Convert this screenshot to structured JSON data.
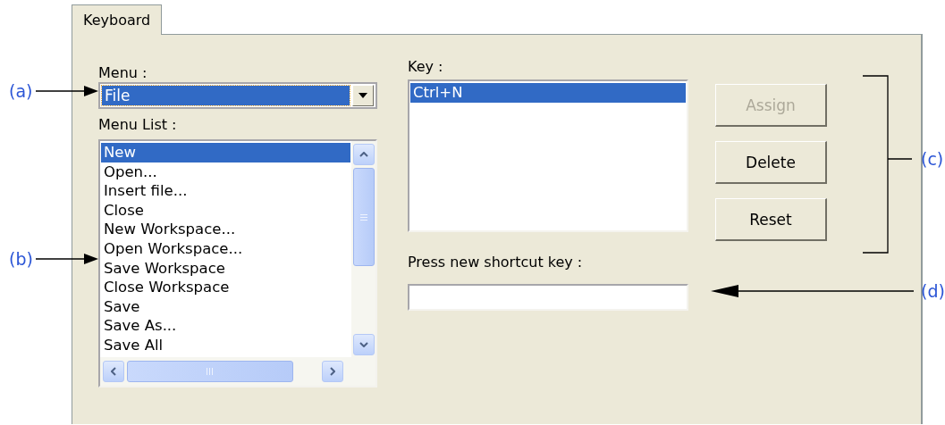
{
  "tab": {
    "label": "Keyboard",
    "selected": true
  },
  "menu_label": "Menu :",
  "menu_combo": {
    "value": "File"
  },
  "menu_list_label": "Menu List :",
  "menu_list": [
    {
      "label": "New",
      "selected": true
    },
    {
      "label": "Open...",
      "selected": false
    },
    {
      "label": "Insert file...",
      "selected": false
    },
    {
      "label": "Close",
      "selected": false
    },
    {
      "label": "New Workspace...",
      "selected": false
    },
    {
      "label": "Open Workspace...",
      "selected": false
    },
    {
      "label": "Save Workspace",
      "selected": false
    },
    {
      "label": "Close Workspace",
      "selected": false
    },
    {
      "label": "Save",
      "selected": false
    },
    {
      "label": "Save As...",
      "selected": false
    },
    {
      "label": "Save All",
      "selected": false
    }
  ],
  "key_label": "Key :",
  "keys": [
    {
      "label": "Ctrl+N",
      "selected": true
    }
  ],
  "shortcut_label": "Press new shortcut key :",
  "buttons": [
    {
      "label": "Assign",
      "disabled": true
    },
    {
      "label": "Delete",
      "disabled": false
    },
    {
      "label": "Reset",
      "disabled": false
    }
  ],
  "callouts": [
    {
      "label": "(a)"
    },
    {
      "label": "(b)"
    },
    {
      "label": "(c)"
    },
    {
      "label": "(d)"
    }
  ]
}
